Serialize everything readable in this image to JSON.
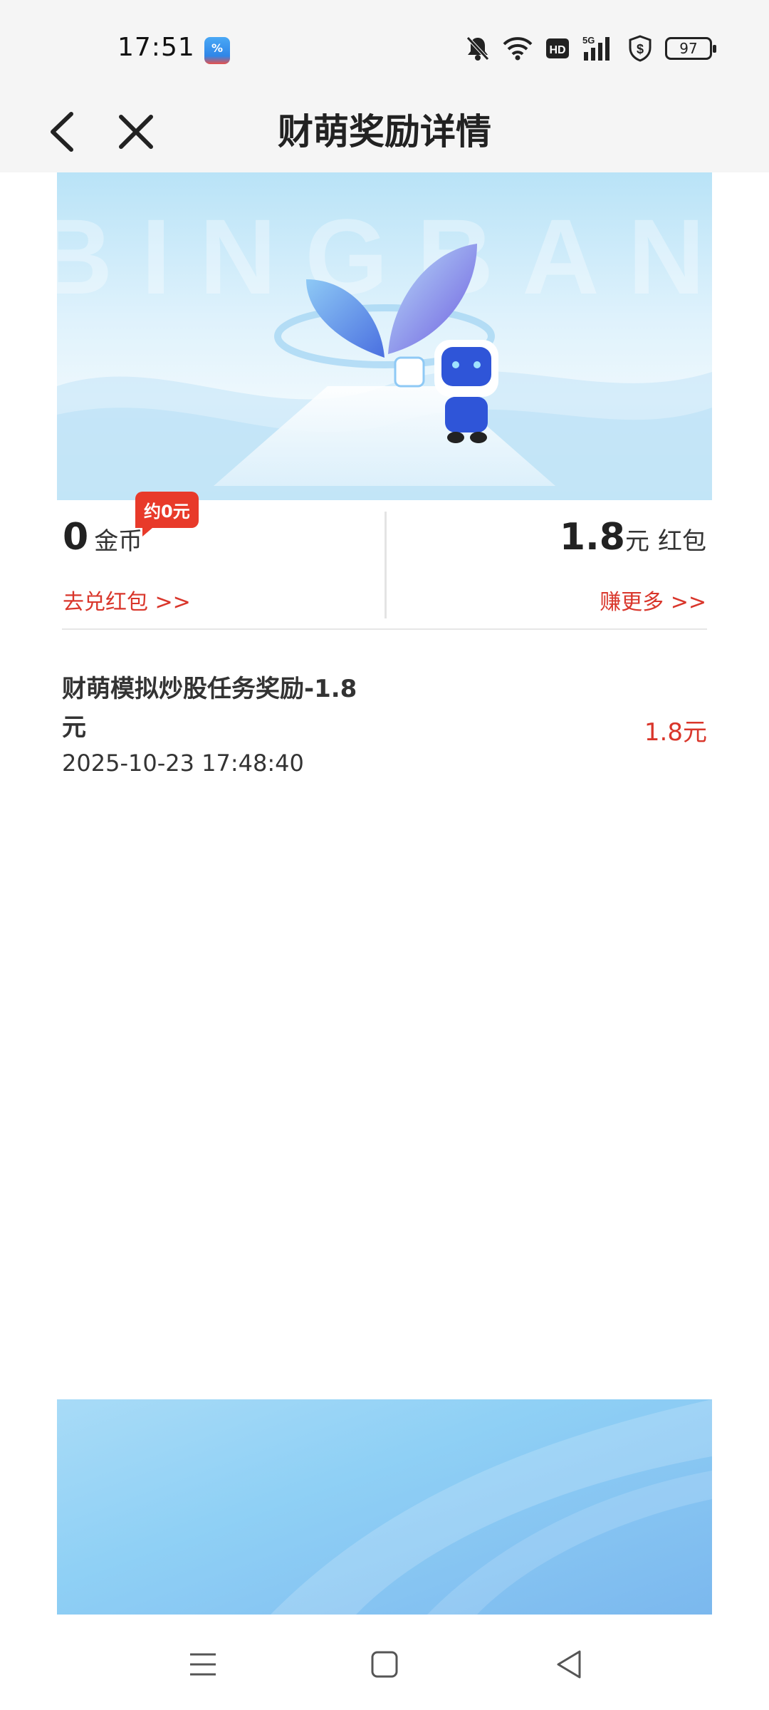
{
  "status_bar": {
    "time": "17:51",
    "battery": "97",
    "icons": [
      "app-icon",
      "mute-bell-icon",
      "wifi-icon",
      "hd-icon",
      "5g-signal-icon",
      "shield-dollar-icon",
      "battery-icon"
    ]
  },
  "nav": {
    "title": "财萌奖励详情",
    "back_icon": "chevron-left-icon",
    "close_icon": "close-icon"
  },
  "banner": {
    "watermark": "BINGBAN"
  },
  "stats": {
    "coins": {
      "value": "0",
      "unit": "金币",
      "badge": "约0元",
      "link": "去兑红包 >>"
    },
    "redpacket": {
      "value": "1.8",
      "unit": "元",
      "label": "红包",
      "link": "赚更多 >>"
    }
  },
  "records": [
    {
      "title": "财萌模拟炒股任务奖励-1.8元",
      "time": "2025-10-23 17:48:40",
      "amount": "1.8元"
    }
  ],
  "colors": {
    "accent_red": "#d9362b",
    "badge_red": "#e83a2a",
    "nav_bg": "#f5f5f5"
  },
  "system_nav": {
    "icons": [
      "menu-icon",
      "home-square-icon",
      "back-triangle-icon"
    ]
  }
}
